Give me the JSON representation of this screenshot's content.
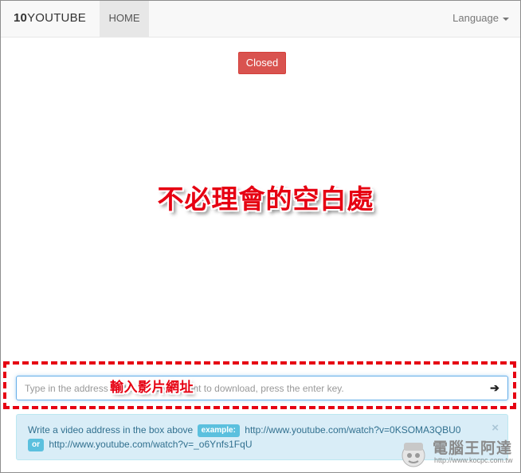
{
  "navbar": {
    "brand_prefix": "10",
    "brand_suffix": "YOUTUBE",
    "home_label": "HOME",
    "language_label": "Language"
  },
  "status_button": {
    "label": "Closed",
    "color": "#d9534f"
  },
  "annotations": {
    "blank_area": "不必理會的空白處",
    "input_hint": "輸入影片網址",
    "color": "#e60012"
  },
  "search": {
    "placeholder": "Type in the address of the video you want to download, press the enter key.",
    "submit_icon": "arrow-right-icon"
  },
  "info_alert": {
    "text_before": "Write a video address in the box above",
    "example_badge": "example:",
    "example_url_1": "http://www.youtube.com/watch?v=0KSOMA3QBU0",
    "or_badge": "or",
    "example_url_2": "http://www.youtube.com/watch?v=_o6Ynfs1FqU",
    "close_icon": "close-icon"
  },
  "watermark": {
    "name": "電腦王阿達",
    "url": "http://www.kocpc.com.tw"
  }
}
